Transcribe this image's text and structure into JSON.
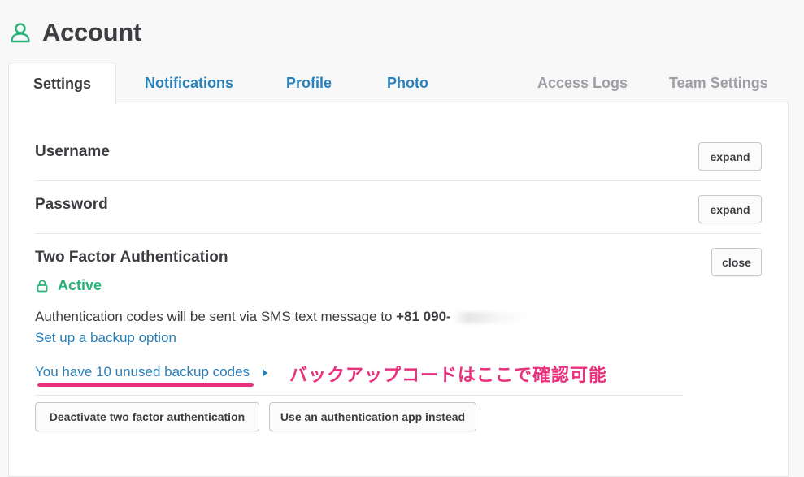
{
  "header": {
    "title": "Account",
    "icon": "user-icon"
  },
  "tabs": [
    {
      "label": "Settings"
    },
    {
      "label": "Notifications"
    },
    {
      "label": "Profile"
    },
    {
      "label": "Photo"
    },
    {
      "label": "Access Logs"
    },
    {
      "label": "Team Settings"
    }
  ],
  "username": {
    "title": "Username",
    "button": "expand"
  },
  "password": {
    "title": "Password",
    "button": "expand"
  },
  "two_factor": {
    "title": "Two Factor Authentication",
    "button": "close",
    "status": "Active",
    "sms_text": "Authentication codes will be sent via SMS text message to ",
    "phone": "+81 090-",
    "backup_option_link": "Set up a backup option",
    "backup_codes_link": "You have 10 unused backup codes",
    "deactivate_button": "Deactivate two factor authentication",
    "auth_app_button": "Use an authentication app instead"
  },
  "annotation": {
    "text": "バックアップコードはここで確認可能"
  },
  "colors": {
    "link": "#2a80b9",
    "active": "#2ab27b",
    "annotation": "#e8327e",
    "muted_tab": "#9e9ea6"
  }
}
